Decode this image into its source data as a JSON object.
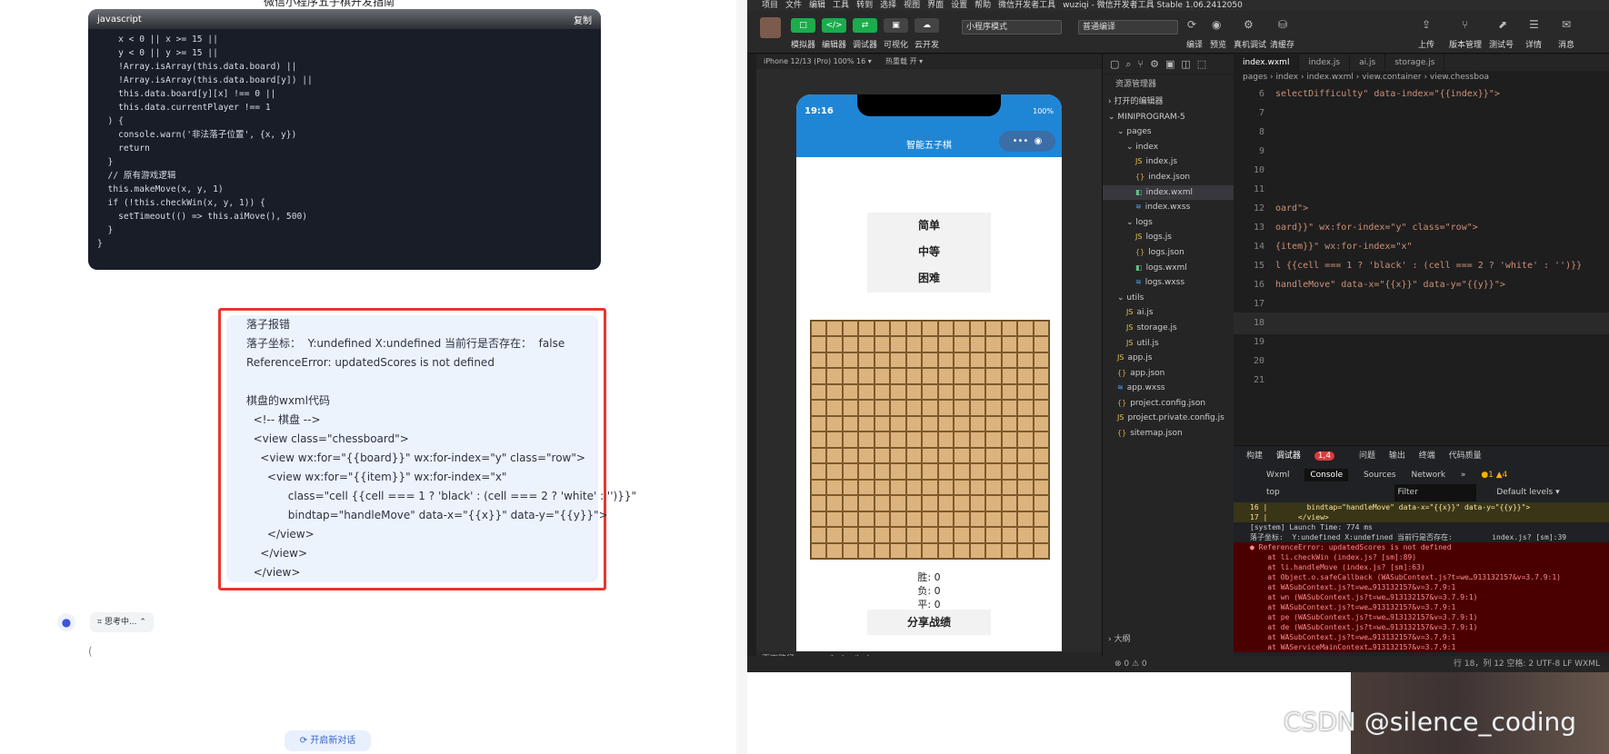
{
  "chat": {
    "title": "微信小程序五子棋开发指南",
    "code_lang": "javascript",
    "copy": "复制",
    "code_lines": [
      "    x < 0 || x >= 15 ||",
      "    y < 0 || y >= 15 ||",
      "    !Array.isArray(this.data.board) ||",
      "    !Array.isArray(this.data.board[y]) ||",
      "    this.data.board[y][x] !== 0 ||",
      "    this.data.currentPlayer !== 1",
      "  ) {",
      "    console.warn('非法落子位置', {x, y})",
      "    return",
      "  }",
      "",
      "  // 原有游戏逻辑",
      "  this.makeMove(x, y, 1)",
      "  if (!this.checkWin(x, y, 1)) {",
      "    setTimeout(() => this.aiMove(), 500)",
      "  }",
      "}"
    ],
    "message_lines": [
      "落子报错",
      "落子坐标：  Y:undefined X:undefined 当前行是否存在：  false",
      "ReferenceError: updatedScores is not defined",
      "",
      "棋盘的wxml代码",
      "  <!-- 棋盘 -->",
      "  <view class=\"chessboard\">",
      "    <view wx:for=\"{{board}}\" wx:for-index=\"y\" class=\"row\">",
      "      <view wx:for=\"{{item}}\" wx:for-index=\"x\"",
      "            class=\"cell {{cell === 1 ? 'black' : (cell === 2 ? 'white' : '')}}\"",
      "            bindtap=\"handleMove\" data-x=\"{{x}}\" data-y=\"{{y}}\">",
      "      </view>",
      "    </view>",
      "  </view>"
    ],
    "thinking": "思考中...",
    "loader": "(",
    "new_chat": "开启新对话"
  },
  "ide": {
    "menu": [
      "项目",
      "文件",
      "编辑",
      "工具",
      "转到",
      "选择",
      "视图",
      "界面",
      "设置",
      "帮助",
      "微信开发者工具",
      "wuziqi - 微信开发者工具 Stable 1.06.2412050"
    ],
    "tool_labels": [
      "模拟器",
      "编辑器",
      "调试器",
      "可视化",
      "云开发",
      "编译",
      "预览",
      "真机调试",
      "清缓存",
      "上传",
      "版本管理",
      "测试号",
      "详情",
      "消息"
    ],
    "mode": "小程序模式",
    "compile_mode": "普通编译",
    "sim_device": "iPhone 12/13 (Pro) 100% 16 ▾",
    "sim_reload": "热重载 开 ▾",
    "phone": {
      "time": "19:16",
      "battery": "100%",
      "title": "智能五子棋",
      "difficulties": [
        "简单",
        "中等",
        "困难"
      ],
      "stats": [
        "胜: 0",
        "负: 0",
        "平: 0"
      ],
      "share": "分享战绩"
    },
    "page_path": "页面路径 ▾   pages/index/index",
    "explorer": {
      "title": "资源管理器",
      "items": [
        "› 打开的编辑器",
        "⌄ MINIPROGRAM-5",
        "⌄ pages",
        "⌄ index",
        "index.js",
        "index.json",
        "index.wxml",
        "index.wxss",
        "⌄ logs",
        "logs.js",
        "logs.json",
        "logs.wxml",
        "logs.wxss",
        "⌄ utils",
        "ai.js",
        "storage.js",
        "util.js",
        "app.js",
        "app.json",
        "app.wxss",
        "project.config.json",
        "project.private.config.js",
        "sitemap.json"
      ],
      "outline": "› 大纲"
    },
    "tabs": [
      "index.wxml",
      "index.js",
      "ai.js",
      "storage.js"
    ],
    "breadcrumb": "pages › index › index.wxml › view.container › view.chessboa",
    "editor_lines": [
      {
        "n": "6",
        "t": "selectDifficulty\" data-index=\"{{index}}\">"
      },
      {
        "n": "7",
        "t": ""
      },
      {
        "n": "8",
        "t": ""
      },
      {
        "n": "9",
        "t": ""
      },
      {
        "n": "10",
        "t": ""
      },
      {
        "n": "11",
        "t": ""
      },
      {
        "n": "12",
        "t": "oard\">"
      },
      {
        "n": "13",
        "t": "oard}}\" wx:for-index=\"y\" class=\"row\">"
      },
      {
        "n": "14",
        "t": "{item}}\" wx:for-index=\"x\""
      },
      {
        "n": "15",
        "t": "l {{cell === 1 ? 'black' : (cell === 2 ? 'white' : '')}}"
      },
      {
        "n": "16",
        "t": "handleMove\" data-x=\"{{x}}\" data-y=\"{{y}}\">"
      },
      {
        "n": "17",
        "t": ""
      },
      {
        "n": "18",
        "t": ""
      },
      {
        "n": "19",
        "t": ""
      },
      {
        "n": "20",
        "t": ""
      },
      {
        "n": "21",
        "t": ""
      }
    ],
    "devtools_tabs": [
      "构建",
      "调试器",
      "问题",
      "输出",
      "终端",
      "代码质量"
    ],
    "devtools_badge": "1,4",
    "console_tabs": [
      "Wxml",
      "Console",
      "Sources",
      "Network",
      "»"
    ],
    "console_counts": "●1 ▲4",
    "console_filter": "top",
    "filter_placeholder": "Filter",
    "levels": "Default levels ▾",
    "console_lines": [
      {
        "type": "warn",
        "text": "16 |         bindtap=\"handleMove\" data-x=\"{{x}}\" data-y=\"{{y}}\">"
      },
      {
        "type": "warn",
        "text": "17 |       </view>"
      },
      {
        "type": "plain",
        "text": "[system] Launch Time: 774 ms"
      },
      {
        "type": "plain",
        "text": "落子坐标:  Y:undefined X:undefined 当前行是否存在:         index.js? [sm]:39"
      },
      {
        "type": "err",
        "text": "● ReferenceError: updatedScores is not defined"
      },
      {
        "type": "err",
        "text": "    at li.checkWin (index.js? [sm]:89)"
      },
      {
        "type": "err",
        "text": "    at li.handleMove (index.js? [sm]:63)"
      },
      {
        "type": "err",
        "text": "    at Object.o.safeCallback (WASubContext.js?t=we…913132157&v=3.7.9:1)"
      },
      {
        "type": "err",
        "text": "    at WASubContext.js?t=we…913132157&v=3.7.9:1"
      },
      {
        "type": "err",
        "text": "    at wn (WASubContext.js?t=we…913132157&v=3.7.9:1)"
      },
      {
        "type": "err",
        "text": "    at WASubContext.js?t=we…913132157&v=3.7.9:1"
      },
      {
        "type": "err",
        "text": "    at pe (WASubContext.js?t=we…913132157&v=3.7.9:1)"
      },
      {
        "type": "err",
        "text": "    at de (WASubContext.js?t=we…913132157&v=3.7.9:1)"
      },
      {
        "type": "err",
        "text": "    at WASubContext.js?t=we…913132157&v=3.7.9:1"
      },
      {
        "type": "err",
        "text": "    at WAServiceMainContext…913132157&v=3.7.9:1"
      }
    ],
    "status_left": "⊗ 0 ⚠ 0",
    "status_right": "行 18，列 12   空格: 2   UTF-8   LF   WXML"
  },
  "watermark": "CSDN @silence_coding"
}
